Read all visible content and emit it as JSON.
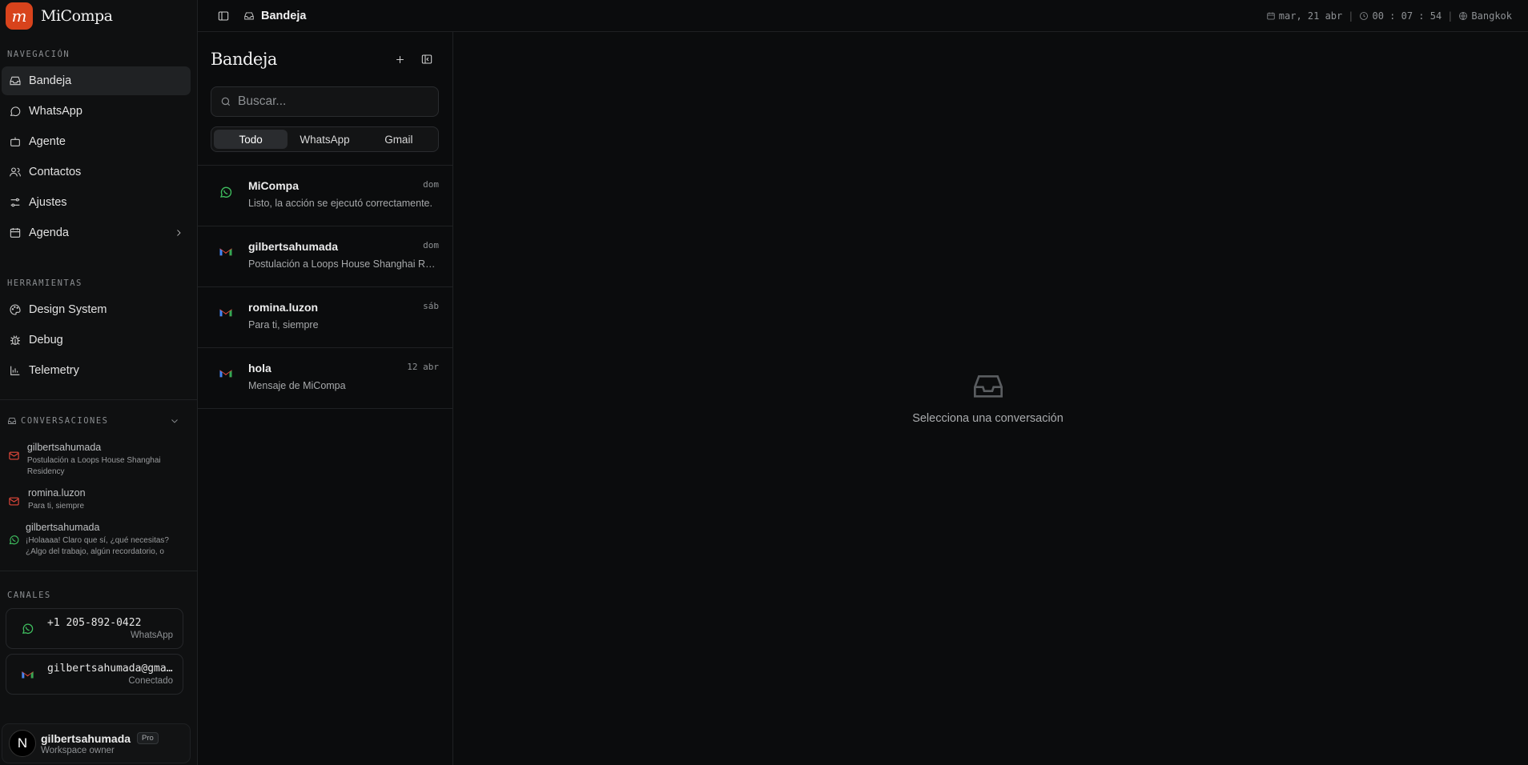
{
  "brand": {
    "logo_letter": "m",
    "name": "MiCompa"
  },
  "sidebar": {
    "nav_label": "NAVEGACIÓN",
    "nav": [
      {
        "label": "Bandeja",
        "icon": "inbox-icon"
      },
      {
        "label": "WhatsApp",
        "icon": "message-circle-icon"
      },
      {
        "label": "Agente",
        "icon": "bot-icon"
      },
      {
        "label": "Contactos",
        "icon": "users-icon"
      },
      {
        "label": "Ajustes",
        "icon": "sliders-icon"
      },
      {
        "label": "Agenda",
        "icon": "calendar-icon"
      }
    ],
    "tools_label": "HERRAMIENTAS",
    "tools": [
      {
        "label": "Design System",
        "icon": "palette-icon"
      },
      {
        "label": "Debug",
        "icon": "bug-icon"
      },
      {
        "label": "Telemetry",
        "icon": "chart-icon"
      }
    ],
    "conversations_label": "CONVERSACIONES",
    "conversations": [
      {
        "name": "gilbertsahumada",
        "preview": "Postulación a Loops House Shanghai Residency",
        "channel": "gmail"
      },
      {
        "name": "romina.luzon",
        "preview": "Para ti, siempre",
        "channel": "gmail"
      },
      {
        "name": "gilbertsahumada",
        "preview": "¡Holaaaa! Claro que sí, ¿qué necesitas? ¿Algo del trabajo, algún recordatorio, o",
        "channel": "whatsapp"
      }
    ],
    "channels_label": "CANALES",
    "channels": [
      {
        "main": "+1 205-892-0422",
        "sub": "WhatsApp",
        "icon": "whatsapp-icon"
      },
      {
        "main": "gilbertsahumada@gma…",
        "sub": "Conectado",
        "icon": "gmail-icon"
      }
    ],
    "user": {
      "initial": "N",
      "name": "gilbertsahumada",
      "badge": "Pro",
      "role": "Workspace owner"
    }
  },
  "topbar": {
    "title": "Bandeja",
    "date": "mar, 21 abr",
    "clock": "00 : 07 : 54",
    "timezone": "Bangkok"
  },
  "list": {
    "title": "Bandeja",
    "search_placeholder": "Buscar...",
    "tabs": [
      "Todo",
      "WhatsApp",
      "Gmail"
    ],
    "active_tab": "Todo",
    "messages": [
      {
        "name": "MiCompa",
        "preview": "Listo, la acción se ejecutó correctamente.",
        "date": "dom",
        "channel": "whatsapp"
      },
      {
        "name": "gilbertsahumada",
        "preview": "Postulación a Loops House Shanghai Re...",
        "date": "dom",
        "channel": "gmail"
      },
      {
        "name": "romina.luzon",
        "preview": "Para ti, siempre",
        "date": "sáb",
        "channel": "gmail"
      },
      {
        "name": "hola",
        "preview": "Mensaje de MiCompa",
        "date": "12 abr",
        "channel": "gmail"
      }
    ]
  },
  "main": {
    "empty_text": "Selecciona una conversación"
  },
  "colors": {
    "accent": "#d8431c",
    "whatsapp": "#3fbf5f",
    "gmail_red": "#e5483b",
    "background": "#0b0c0d"
  }
}
